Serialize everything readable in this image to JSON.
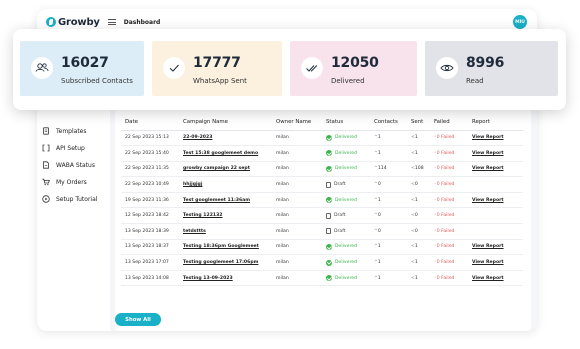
{
  "app": {
    "logo_text": "Growby",
    "page_title": "Dashboard",
    "avatar_initials": "MIU",
    "accent_color": "#1ab0c7"
  },
  "stats": [
    {
      "value": "16027",
      "label": "Subscribed Contacts",
      "icon": "users-icon",
      "bg": "#dcedf7"
    },
    {
      "value": "17777",
      "label": "WhatsApp Sent",
      "icon": "check-icon",
      "bg": "#fbf1de"
    },
    {
      "value": "12050",
      "label": "Delivered",
      "icon": "double-check-icon",
      "bg": "#f8e2ec"
    },
    {
      "value": "8996",
      "label": "Read",
      "icon": "eye-icon",
      "bg": "#e1e3e8"
    }
  ],
  "sidebar": {
    "items": [
      {
        "label": "Templates",
        "icon": "document-icon"
      },
      {
        "label": "API Setup",
        "icon": "brackets-icon"
      },
      {
        "label": "WABA Status",
        "icon": "file-icon"
      },
      {
        "label": "My Orders",
        "icon": "cart-icon"
      },
      {
        "label": "Setup Tutorial",
        "icon": "play-icon"
      }
    ]
  },
  "table": {
    "headers": [
      "Date",
      "Campaign Name",
      "Owner Name",
      "Status",
      "Contacts",
      "Sent",
      "Failed",
      "Report"
    ],
    "rows": [
      {
        "date": "22 Sep 2023 15:13",
        "campaign": "22-09-2023",
        "owner": "milan",
        "status": "Delivered",
        "contacts": "1",
        "sent": "1",
        "failed": "0 Failed",
        "report": "View Report"
      },
      {
        "date": "22 Sep 2023 15:40",
        "campaign": "Test 15:38 googlemeet demo",
        "owner": "milan",
        "status": "Delivered",
        "contacts": "1",
        "sent": "1",
        "failed": "0 Failed",
        "report": "View Report"
      },
      {
        "date": "22 Sep 2023 11:35",
        "campaign": "growby campaign 22 sept",
        "owner": "milan",
        "status": "Delivered",
        "contacts": "114",
        "sent": "108",
        "failed": "0 Failed",
        "report": "View Report"
      },
      {
        "date": "22 Sep 2023 10:49",
        "campaign": "hhjjgjgj",
        "owner": "milan",
        "status": "Draft",
        "contacts": "0",
        "sent": "0",
        "failed": "0 Failed",
        "report": ""
      },
      {
        "date": "19 Sep 2023 11:36",
        "campaign": "Test googlemeet 11:36am",
        "owner": "milan",
        "status": "Delivered",
        "contacts": "1",
        "sent": "1",
        "failed": "0 Failed",
        "report": "View Report"
      },
      {
        "date": "12 Sep 2023 18:42",
        "campaign": "Testing 122132",
        "owner": "milan",
        "status": "Draft",
        "contacts": "0",
        "sent": "0",
        "failed": "0 Failed",
        "report": ""
      },
      {
        "date": "13 Sep 2023 18:39",
        "campaign": "tetdsttts",
        "owner": "milan",
        "status": "Draft",
        "contacts": "0",
        "sent": "0",
        "failed": "0 Failed",
        "report": ""
      },
      {
        "date": "13 Sep 2023 18:37",
        "campaign": "Testing 18:36pm Googlemeet",
        "owner": "milan",
        "status": "Delivered",
        "contacts": "1",
        "sent": "1",
        "failed": "0 Failed",
        "report": "View Report"
      },
      {
        "date": "13 Sep 2023 17:07",
        "campaign": "Testing googlemeet 17:06pm",
        "owner": "milan",
        "status": "Delivered",
        "contacts": "1",
        "sent": "1",
        "failed": "0 Failed",
        "report": "View Report"
      },
      {
        "date": "13 Sep 2023 14:08",
        "campaign": "Testing 13-09-2023",
        "owner": "milan",
        "status": "Delivered",
        "contacts": "1",
        "sent": "1",
        "failed": "0 Failed",
        "report": "View Report"
      }
    ]
  },
  "show_all_label": "Show All"
}
